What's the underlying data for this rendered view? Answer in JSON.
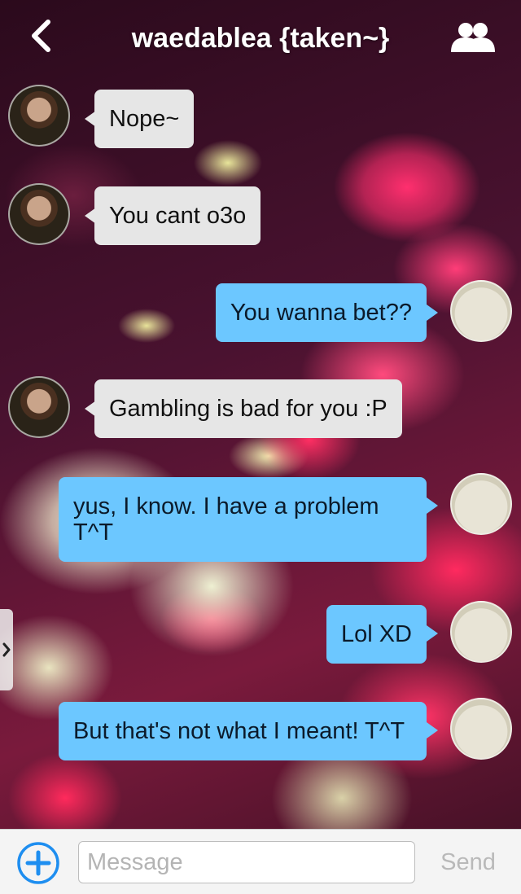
{
  "header": {
    "title": "waedablea {taken~}",
    "back_icon": "chevron-left-icon",
    "group_icon": "group-icon"
  },
  "messages": [
    {
      "direction": "incoming",
      "text": "Nope~",
      "avatar": "contact-avatar"
    },
    {
      "direction": "incoming",
      "text": "You cant o3o",
      "avatar": "contact-avatar"
    },
    {
      "direction": "outgoing",
      "text": "You wanna bet??",
      "avatar": "user-avatar"
    },
    {
      "direction": "incoming",
      "text": "Gambling is bad for you  :P",
      "avatar": "contact-avatar"
    },
    {
      "direction": "outgoing",
      "text": "yus, I know. I have a problem T^T",
      "avatar": "user-avatar"
    },
    {
      "direction": "outgoing",
      "text": "Lol XD",
      "avatar": "user-avatar"
    },
    {
      "direction": "outgoing",
      "text": "But that's not what I meant! T^T",
      "avatar": "user-avatar"
    }
  ],
  "composer": {
    "placeholder": "Message",
    "send_label": "Send",
    "add_icon": "plus-circle-icon"
  },
  "colors": {
    "outgoing_bubble": "#6cc7ff",
    "incoming_bubble": "#e6e6e6",
    "accent": "#1e8ef0"
  }
}
